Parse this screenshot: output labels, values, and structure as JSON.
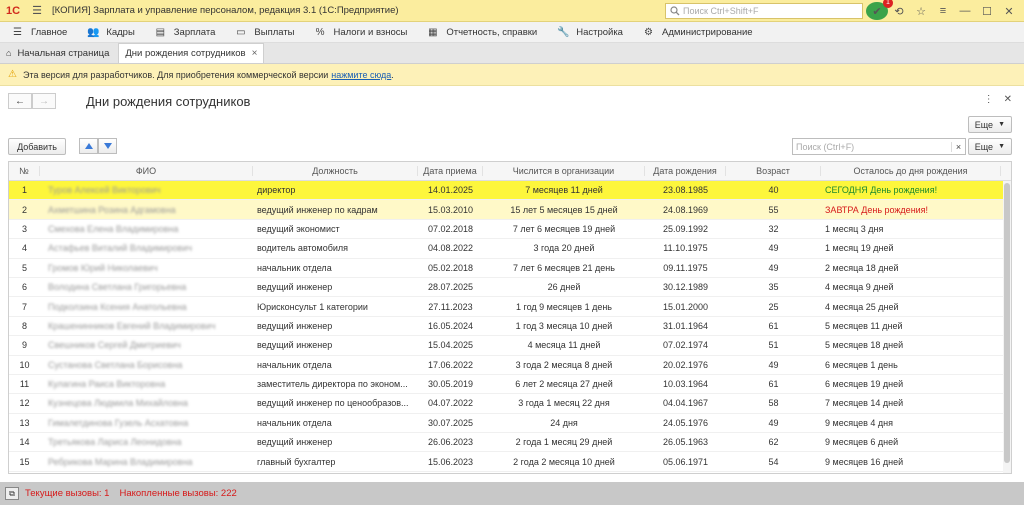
{
  "app": {
    "title": "[КОПИЯ] Зарплата и управление персоналом, редакция 3.1  (1С:Предприятие)",
    "search_placeholder": "Поиск Ctrl+Shift+F",
    "notification_count": "1"
  },
  "menu": [
    {
      "label": "Главное",
      "icon": "menu-icon"
    },
    {
      "label": "Кадры",
      "icon": "people-icon"
    },
    {
      "label": "Зарплата",
      "icon": "document-icon"
    },
    {
      "label": "Выплаты",
      "icon": "wallet-icon"
    },
    {
      "label": "Налоги и взносы",
      "icon": "percent-icon"
    },
    {
      "label": "Отчетность, справки",
      "icon": "report-icon"
    },
    {
      "label": "Настройка",
      "icon": "wrench-icon"
    },
    {
      "label": "Администрирование",
      "icon": "gear-icon"
    }
  ],
  "tabs": {
    "home": "Начальная страница",
    "active": "Дни рождения сотрудников"
  },
  "notice": {
    "text": "Эта версия для разработчиков. Для приобретения коммерческой версии",
    "link": "нажмите сюда",
    "end": "."
  },
  "form": {
    "title": "Дни рождения сотрудников",
    "more_label": "Еще",
    "add_label": "Добавить",
    "search_placeholder": "Поиск (Ctrl+F)",
    "clear_label": "×"
  },
  "table": {
    "columns": [
      "№",
      "ФИО",
      "Должность",
      "Дата приема",
      "Числится в организации",
      "Дата рождения",
      "Возраст",
      "Осталось до дня рождения"
    ],
    "rows": [
      {
        "n": "1",
        "fio": "Туров Алексей Викторович",
        "pos": "директор",
        "hire": "14.01.2025",
        "tenure": "7 месяцев 11 дней",
        "birth": "23.08.1985",
        "age": "40",
        "left": "СЕГОДНЯ День рождения!"
      },
      {
        "n": "2",
        "fio": "Ахметшина Розина Адгамовна",
        "pos": "ведущий инженер по кадрам",
        "hire": "15.03.2010",
        "tenure": "15 лет 5 месяцев 15 дней",
        "birth": "24.08.1969",
        "age": "55",
        "left": "ЗАВТРА День рождения!"
      },
      {
        "n": "3",
        "fio": "Смехова Елена Владимировна",
        "pos": "ведущий экономист",
        "hire": "07.02.2018",
        "tenure": "7 лет 6 месяцев 19 дней",
        "birth": "25.09.1992",
        "age": "32",
        "left": "1 месяц 3 дня"
      },
      {
        "n": "4",
        "fio": "Астафьев Виталий Владимирович",
        "pos": "водитель автомобиля",
        "hire": "04.08.2022",
        "tenure": "3 года 20 дней",
        "birth": "11.10.1975",
        "age": "49",
        "left": "1 месяц 19 дней"
      },
      {
        "n": "5",
        "fio": "Громов Юрий Николаевич",
        "pos": "начальник отдела",
        "hire": "05.02.2018",
        "tenure": "7 лет 6 месяцев 21 день",
        "birth": "09.11.1975",
        "age": "49",
        "left": "2 месяца 18 дней"
      },
      {
        "n": "6",
        "fio": "Володина Светлана Григорьевна",
        "pos": "ведущий инженер",
        "hire": "28.07.2025",
        "tenure": "26 дней",
        "birth": "30.12.1989",
        "age": "35",
        "left": "4 месяца 9 дней"
      },
      {
        "n": "7",
        "fio": "Подколзина Ксения Анатольевна",
        "pos": "Юрисконсульт 1 категории",
        "hire": "27.11.2023",
        "tenure": "1 год 9 месяцев 1 день",
        "birth": "15.01.2000",
        "age": "25",
        "left": "4 месяца 25 дней"
      },
      {
        "n": "8",
        "fio": "Крашенинников Евгений Владимирович",
        "pos": "ведущий инженер",
        "hire": "16.05.2024",
        "tenure": "1 год 3 месяца 10 дней",
        "birth": "31.01.1964",
        "age": "61",
        "left": "5 месяцев 11 дней"
      },
      {
        "n": "9",
        "fio": "Свешников Сергей Дмитриевич",
        "pos": "ведущий инженер",
        "hire": "15.04.2025",
        "tenure": "4 месяца 11 дней",
        "birth": "07.02.1974",
        "age": "51",
        "left": "5 месяцев 18 дней"
      },
      {
        "n": "10",
        "fio": "Сустанова Светлана Борисовна",
        "pos": "начальник отдела",
        "hire": "17.06.2022",
        "tenure": "3 года 2 месяца 8 дней",
        "birth": "20.02.1976",
        "age": "49",
        "left": "6 месяцев 1 день"
      },
      {
        "n": "11",
        "fio": "Кулагина Раиса Викторовна",
        "pos": "заместитель директора по эконом...",
        "hire": "30.05.2019",
        "tenure": "6 лет 2 месяца 27 дней",
        "birth": "10.03.1964",
        "age": "61",
        "left": "6 месяцев 19 дней"
      },
      {
        "n": "12",
        "fio": "Кузнецова Людмила Михайловна",
        "pos": "ведущий инженер по ценообразов...",
        "hire": "04.07.2022",
        "tenure": "3 года 1 месяц 22 дня",
        "birth": "04.04.1967",
        "age": "58",
        "left": "7 месяцев 14 дней"
      },
      {
        "n": "13",
        "fio": "Гималетдинова Гузель Асхатовна",
        "pos": "начальник отдела",
        "hire": "30.07.2025",
        "tenure": "24 дня",
        "birth": "24.05.1976",
        "age": "49",
        "left": "9 месяцев 4 дня"
      },
      {
        "n": "14",
        "fio": "Третьякова Лариса Леонидовна",
        "pos": "ведущий инженер",
        "hire": "26.06.2023",
        "tenure": "2 года 1 месяц 29 дней",
        "birth": "26.05.1963",
        "age": "62",
        "left": "9 месяцев 6 дней"
      },
      {
        "n": "15",
        "fio": "Ребрикова Марина Владимировна",
        "pos": "главный бухгалтер",
        "hire": "15.06.2023",
        "tenure": "2 года 2 месяца 10 дней",
        "birth": "05.06.1971",
        "age": "54",
        "left": "9 месяцев 16 дней"
      }
    ]
  },
  "status": {
    "current_calls": "Текущие вызовы: 1",
    "accumulated_calls": "Накопленные вызовы: 222"
  },
  "colors": {
    "title_bar": "#fbed9e",
    "selected_row": "#fdf63c",
    "today": "#1e8a2c",
    "tomorrow": "#d61a1a"
  }
}
